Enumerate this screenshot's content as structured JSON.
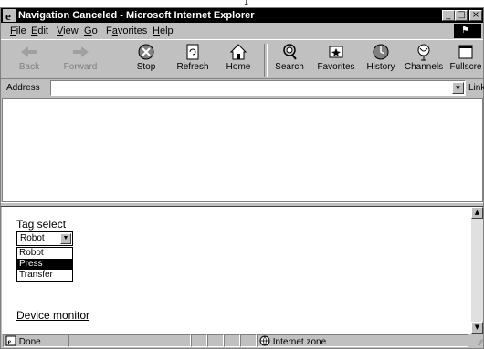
{
  "window": {
    "title": "Navigation Canceled - Microsoft Internet Explorer"
  },
  "menu": [
    "File",
    "Edit",
    "View",
    "Go",
    "Favorites",
    "Help"
  ],
  "toolbar": {
    "back": "Back",
    "forward": "Forward",
    "stop": "Stop",
    "refresh": "Refresh",
    "home": "Home",
    "search": "Search",
    "favorites": "Favorites",
    "history": "History",
    "channels": "Channels",
    "fullscreen": "Fullscre"
  },
  "address": {
    "label": "Address",
    "value": "",
    "links": "Links"
  },
  "page": {
    "tag_label": "Tag select",
    "tag_selected": "Robot",
    "tag_options": [
      "Robot",
      "Press",
      "Transfer"
    ],
    "tag_highlighted_index": 1,
    "device_monitor": "Device monitor"
  },
  "status": {
    "left": "Done",
    "zone": "Internet zone"
  }
}
